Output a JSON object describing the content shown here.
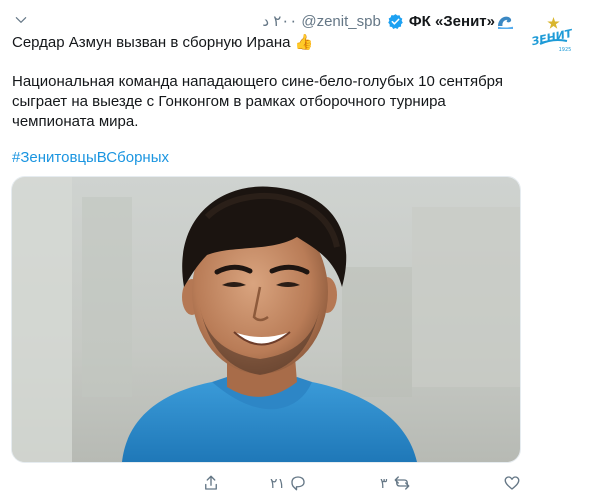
{
  "header": {
    "time": "٢٠٠ د",
    "handle": "@zenit_spb",
    "display_name": "ФК «Зенит»"
  },
  "avatar": {
    "text": "ЗЕНИТ",
    "year": "1925"
  },
  "tweet": {
    "line1": "Сердар Азмун вызван в сборную Ирана",
    "thumbs_emoji": "👍",
    "paragraph": "Национальная команда нападающего сине-бело-голубых 10 сентября сыграет на выезде с Гонконгом в рамках отборочного турнира чемпионата мира.",
    "hashtag": "#ЗенитовцыВСборных"
  },
  "actions": {
    "reply_count": "٢١",
    "retweet_count": "٣"
  },
  "colors": {
    "accent": "#1b95e0",
    "muted": "#657786",
    "text": "#14171a"
  }
}
